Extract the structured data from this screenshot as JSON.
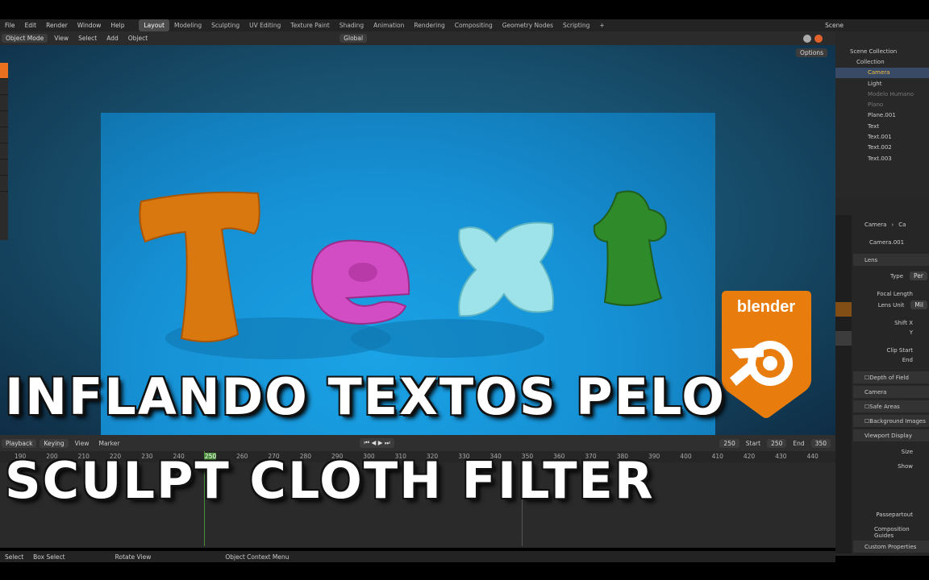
{
  "menu": [
    "File",
    "Edit",
    "Render",
    "Window",
    "Help"
  ],
  "workspaces": [
    "Layout",
    "Modeling",
    "Sculpting",
    "UV Editing",
    "Texture Paint",
    "Shading",
    "Animation",
    "Rendering",
    "Compositing",
    "Geometry Nodes",
    "Scripting"
  ],
  "scene_label": "Scene",
  "header": {
    "mode": "Object Mode",
    "view": "View",
    "select": "Select",
    "add": "Add",
    "object": "Object",
    "orientation": "Global",
    "options": "Options"
  },
  "outliner": {
    "title": "Scene Collection",
    "collection": "Collection",
    "items": [
      "Camera",
      "Light",
      "Modelo Humano",
      "Plano",
      "Plane.001",
      "Text",
      "Text.001",
      "Text.002",
      "Text.003"
    ]
  },
  "properties": {
    "breadcrumb_a": "Camera",
    "breadcrumb_b": "Ca",
    "data_name": "Camera.001",
    "lens": "Lens",
    "type": "Type",
    "type_value": "Per",
    "focal": "Focal Length",
    "lens_unit": "Lens Unit",
    "lens_unit_value": "Mil",
    "shift_x": "Shift X",
    "y": "Y",
    "clip_start": "Clip Start",
    "end": "End",
    "dof": "Depth of Field",
    "camera": "Camera",
    "safe_areas": "Safe Areas",
    "bg_images": "Background Images",
    "viewport_display": "Viewport Display",
    "size": "Size",
    "show": "Show",
    "passepartout": "Passepartout",
    "comp_guides": "Composition Guides",
    "custom_props": "Custom Properties"
  },
  "timeline": {
    "playback": "Playback",
    "keying": "Keying",
    "view": "View",
    "marker": "Marker",
    "current_frame": "250",
    "start_label": "Start",
    "start": "250",
    "end_label": "End",
    "end": "350",
    "ticks": [
      "190",
      "200",
      "210",
      "220",
      "230",
      "240",
      "250",
      "260",
      "270",
      "280",
      "290",
      "300",
      "310",
      "320",
      "330",
      "340",
      "350",
      "360",
      "370",
      "380",
      "390",
      "400",
      "410",
      "420",
      "430",
      "440"
    ]
  },
  "statusbar": {
    "select": "Select",
    "box_select": "Box Select",
    "rotate": "Rotate View",
    "context": "Object Context Menu"
  },
  "overlay": {
    "line1": "INFLANDO TEXTOS PELO",
    "line2": "SCULPT CLOTH FILTER"
  },
  "logo": {
    "text": "blender"
  },
  "colors": {
    "accent": "#e87d0d",
    "selected": "#394a66",
    "active_frame": "#4a8c3a"
  }
}
